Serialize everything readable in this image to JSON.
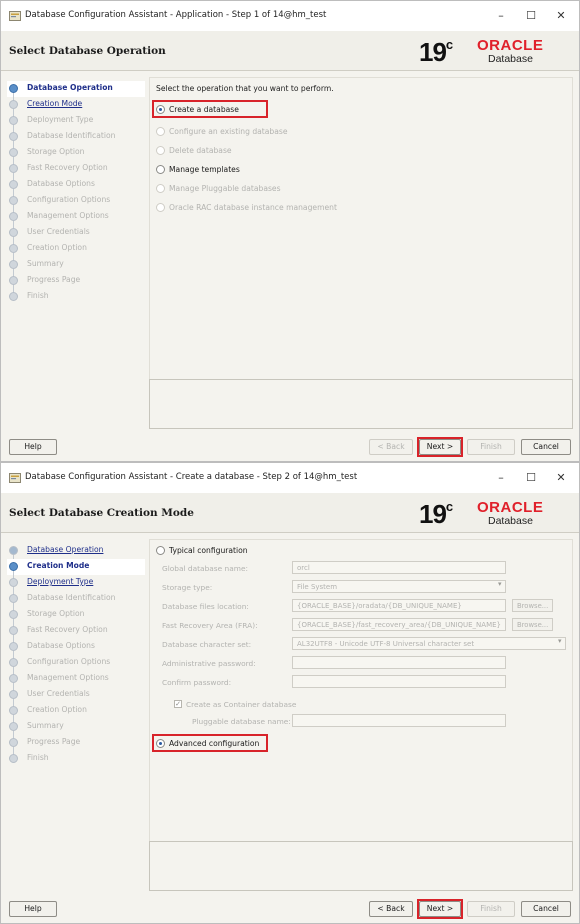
{
  "colors": {
    "oracle_red": "#e0202a",
    "highlight_box": "#d8232a",
    "link_blue": "#1f2f8a",
    "disabled_text": "#b3b3b0"
  },
  "window1": {
    "title": "Database Configuration Assistant - Application - Step 1 of 14@hm_test",
    "window_controls": {
      "minimize": "–",
      "maximize": "☐",
      "close": "✕"
    },
    "page_title": "Select Database Operation",
    "logo": {
      "version": "19",
      "superscript": "c",
      "brand": "ORACLE",
      "product": "Database"
    },
    "steps": [
      {
        "label": "Database Operation",
        "state": "current"
      },
      {
        "label": "Creation Mode",
        "state": "next"
      },
      {
        "label": "Deployment Type",
        "state": "disabled"
      },
      {
        "label": "Database Identification",
        "state": "disabled"
      },
      {
        "label": "Storage Option",
        "state": "disabled"
      },
      {
        "label": "Fast Recovery Option",
        "state": "disabled"
      },
      {
        "label": "Database Options",
        "state": "disabled"
      },
      {
        "label": "Configuration Options",
        "state": "disabled"
      },
      {
        "label": "Management Options",
        "state": "disabled"
      },
      {
        "label": "User Credentials",
        "state": "disabled"
      },
      {
        "label": "Creation Option",
        "state": "disabled"
      },
      {
        "label": "Summary",
        "state": "disabled"
      },
      {
        "label": "Progress Page",
        "state": "disabled"
      },
      {
        "label": "Finish",
        "state": "disabled"
      }
    ],
    "instruction": "Select the operation that you want to perform.",
    "options": [
      {
        "label": "Create a database",
        "selected": true,
        "enabled": true
      },
      {
        "label": "Configure an existing database",
        "selected": false,
        "enabled": false
      },
      {
        "label": "Delete database",
        "selected": false,
        "enabled": false
      },
      {
        "label": "Manage templates",
        "selected": false,
        "enabled": true
      },
      {
        "label": "Manage Pluggable databases",
        "selected": false,
        "enabled": false
      },
      {
        "label": "Oracle RAC database instance management",
        "selected": false,
        "enabled": false
      }
    ],
    "buttons": {
      "help": "Help",
      "back": "< Back",
      "next": "Next >",
      "finish": "Finish",
      "cancel": "Cancel"
    }
  },
  "window2": {
    "title": "Database Configuration Assistant - Create a database - Step 2 of 14@hm_test",
    "window_controls": {
      "minimize": "–",
      "maximize": "☐",
      "close": "✕"
    },
    "page_title": "Select Database Creation Mode",
    "logo": {
      "version": "19",
      "superscript": "c",
      "brand": "ORACLE",
      "product": "Database"
    },
    "steps": [
      {
        "label": "Database Operation",
        "state": "done"
      },
      {
        "label": "Creation Mode",
        "state": "current"
      },
      {
        "label": "Deployment Type",
        "state": "next"
      },
      {
        "label": "Database Identification",
        "state": "disabled"
      },
      {
        "label": "Storage Option",
        "state": "disabled"
      },
      {
        "label": "Fast Recovery Option",
        "state": "disabled"
      },
      {
        "label": "Database Options",
        "state": "disabled"
      },
      {
        "label": "Configuration Options",
        "state": "disabled"
      },
      {
        "label": "Management Options",
        "state": "disabled"
      },
      {
        "label": "User Credentials",
        "state": "disabled"
      },
      {
        "label": "Creation Option",
        "state": "disabled"
      },
      {
        "label": "Summary",
        "state": "disabled"
      },
      {
        "label": "Progress Page",
        "state": "disabled"
      },
      {
        "label": "Finish",
        "state": "disabled"
      }
    ],
    "typical_label": "Typical configuration",
    "fields": [
      {
        "label": "Global database name:",
        "value": "orcl"
      },
      {
        "label": "Storage type:",
        "value": "File System"
      },
      {
        "label": "Database files location:",
        "value": "{ORACLE_BASE}/oradata/{DB_UNIQUE_NAME}",
        "button": "Browse..."
      },
      {
        "label": "Fast Recovery Area (FRA):",
        "value": "{ORACLE_BASE}/fast_recovery_area/{DB_UNIQUE_NAME}",
        "button": "Browse..."
      },
      {
        "label": "Database character set:",
        "value": "AL32UTF8 - Unicode UTF-8 Universal character set"
      },
      {
        "label": "Administrative password:",
        "value": ""
      },
      {
        "label": "Confirm password:",
        "value": ""
      }
    ],
    "container_checkbox_label": "Create as Container database",
    "container_checked": true,
    "pluggable_label": "Pluggable database name:",
    "pluggable_value": "",
    "advanced_label": "Advanced configuration",
    "advanced_selected": true,
    "buttons": {
      "help": "Help",
      "back": "< Back",
      "next": "Next >",
      "finish": "Finish",
      "cancel": "Cancel"
    }
  }
}
